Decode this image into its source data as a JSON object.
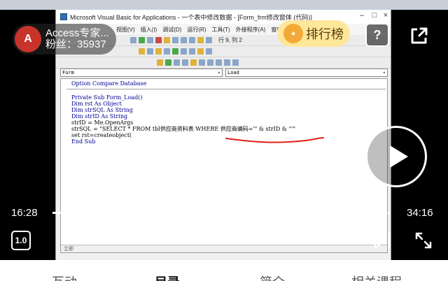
{
  "vba_window": {
    "title": "Microsoft Visual Basic for Applications - 一个表中修改数据 - [Form_frm修改窗体 (代码)]",
    "menu": [
      "视图(V)",
      "插入(I)",
      "调试(D)",
      "运行(R)",
      "工具(T)",
      "外接程序(A)",
      "窗口(W)"
    ],
    "position": "行 9, 列 2",
    "object_combo": "Form",
    "procedure_combo": "Load",
    "code_lines": [
      "Option Compare Database",
      "",
      "Private Sub Form_Load()",
      "Dim rst As Object",
      "Dim strSQL As String",
      "Dim strID As String",
      "strID = Me.OpenArgs",
      "strSQL = \"SELECT * FROM tbl供应商资料表 WHERE 供应商编码='\" & strID & \"'\"",
      "set rst=createobject(",
      "End Sub"
    ],
    "bottom_label": "立即"
  },
  "uploader": {
    "avatar_text": "A",
    "name": "Access专家...",
    "fans": "粉丝：35937"
  },
  "rank_pill": {
    "label": "排行榜"
  },
  "playback": {
    "current_time": "16:28",
    "total_time": "34:16",
    "progress": 0.48,
    "speed_label": "1.0"
  },
  "icons": {
    "help": "help-icon",
    "share": "share-icon",
    "play": "play-icon",
    "next": "next-episode-icon",
    "fullscreen": "fullscreen-icon"
  },
  "tabs": [
    "互动",
    "目录",
    "简介",
    "相关课程"
  ],
  "colors": {
    "annotation": "#e0201b",
    "rank_bg": "#ffe79a",
    "player_bg": "#000000"
  }
}
